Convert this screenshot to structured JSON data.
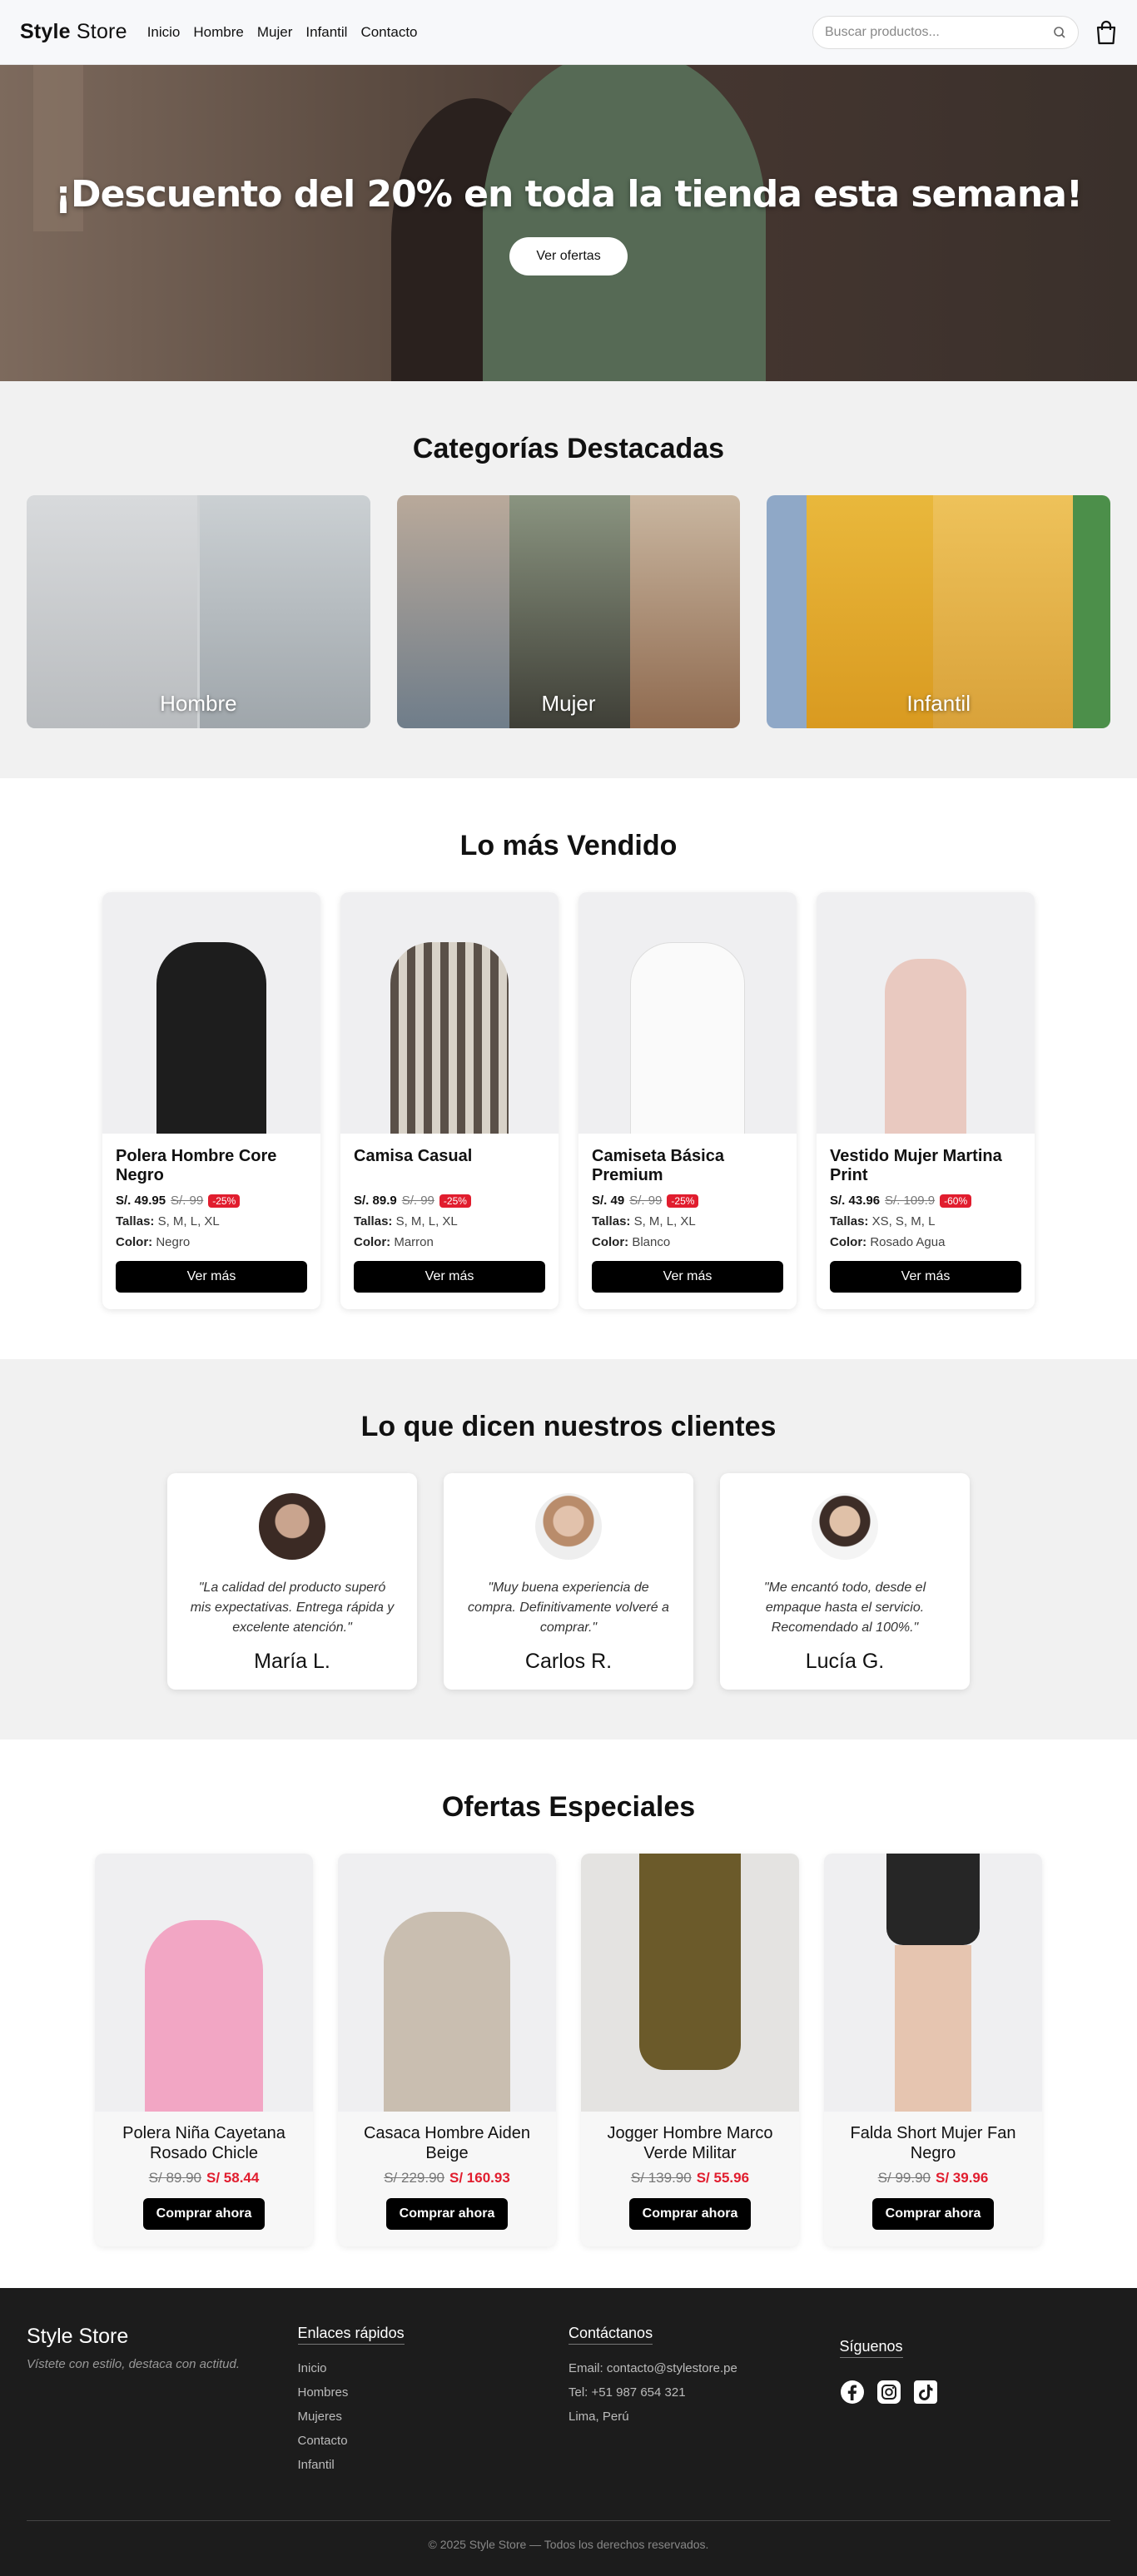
{
  "header": {
    "brand_bold": "Style",
    "brand_rest": "Store",
    "menu": [
      "Inicio",
      "Hombre",
      "Mujer",
      "Infantil",
      "Contacto"
    ],
    "search_placeholder": "Buscar productos..."
  },
  "hero": {
    "title": "¡Descuento del 20% en toda la tienda esta semana!",
    "button": "Ver ofertas"
  },
  "categories": {
    "title": "Categorías Destacadas",
    "items": [
      "Hombre",
      "Mujer",
      "Infantil"
    ]
  },
  "bestsellers": {
    "title": "Lo más Vendido",
    "tallas_label": "Tallas:",
    "color_label": "Color:",
    "button": "Ver más",
    "items": [
      {
        "name": "Polera Hombre Core Negro",
        "price": "S/. 49.95",
        "old": "S/. 99",
        "badge": "-25%",
        "sizes": "S, M, L, XL",
        "color": "Negro"
      },
      {
        "name": "Camisa Casual",
        "price": "S/. 89.9",
        "old": "S/. 99",
        "badge": "-25%",
        "sizes": "S, M, L, XL",
        "color": "Marron"
      },
      {
        "name": "Camiseta Básica Premium",
        "price": "S/. 49",
        "old": "S/. 99",
        "badge": "-25%",
        "sizes": "S, M, L, XL",
        "color": "Blanco"
      },
      {
        "name": "Vestido Mujer Martina Print",
        "price": "S/. 43.96",
        "old": "S/. 109.9",
        "badge": "-60%",
        "sizes": "XS, S, M, L",
        "color": "Rosado Agua"
      }
    ]
  },
  "testimonials": {
    "title": "Lo que dicen nuestros clientes",
    "items": [
      {
        "quote": "\"La calidad del producto superó mis expectativas. Entrega rápida y excelente atención.\"",
        "name": "María L."
      },
      {
        "quote": "\"Muy buena experiencia de compra. Definitivamente volveré a comprar.\"",
        "name": "Carlos R."
      },
      {
        "quote": "\"Me encantó todo, desde el empaque hasta el servicio. Recomendado al 100%.\"",
        "name": "Lucía G."
      }
    ]
  },
  "offers": {
    "title": "Ofertas Especiales",
    "button": "Comprar ahora",
    "items": [
      {
        "name": "Polera Niña Cayetana Rosado Chicle",
        "old": "S/ 89.90",
        "new": "S/ 58.44"
      },
      {
        "name": "Casaca Hombre Aiden Beige",
        "old": "S/ 229.90",
        "new": "S/ 160.93"
      },
      {
        "name": "Jogger Hombre Marco Verde Militar",
        "old": "S/ 139.90",
        "new": "S/ 55.96"
      },
      {
        "name": "Falda Short Mujer Fan Negro",
        "old": "S/ 99.90",
        "new": "S/ 39.96"
      }
    ]
  },
  "footer": {
    "brand": "Style Store",
    "tagline": "Vístete con estilo, destaca con actitud.",
    "links_title": "Enlaces rápidos",
    "links": [
      "Inicio",
      "Hombres",
      "Mujeres",
      "Contacto",
      "Infantil"
    ],
    "contact_title": "Contáctanos",
    "contact": [
      "Email: contacto@stylestore.pe",
      "Tel: +51 987 654 321",
      "Lima, Perú"
    ],
    "social_title": "Síguenos",
    "social_icons": [
      "facebook-icon",
      "instagram-icon",
      "tiktok-icon"
    ],
    "copyright": "© 2025 Style Store — Todos los derechos reservados."
  }
}
